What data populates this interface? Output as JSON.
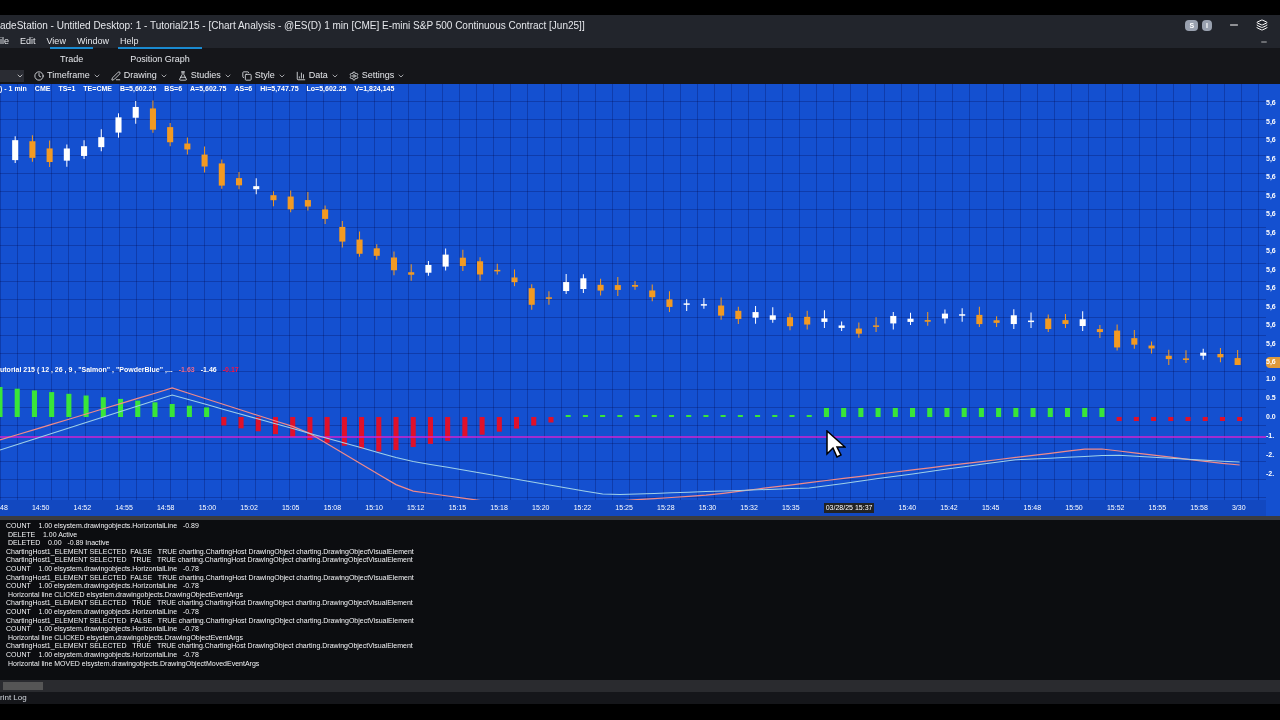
{
  "window": {
    "title": "adeStation  - Untitled Desktop: 1 - Tutorial215 - [Chart Analysis - @ES(D) 1 min [CME] E-mini S&P 500 Continuous Contract [Jun25]]",
    "buttons": [
      "S",
      "I"
    ]
  },
  "menu": [
    "ile",
    "Edit",
    "View",
    "Window",
    "Help"
  ],
  "tabs": [
    "Trade",
    "Position Graph"
  ],
  "toolbar": [
    "Timeframe",
    "Drawing",
    "Studies",
    "Style",
    "Data",
    "Settings"
  ],
  "chart": {
    "status_line": [
      ") - 1 min",
      "CME",
      "TS=1",
      "TE=CME",
      "B=5,602.25",
      "BS=6",
      "A=5,602.75",
      "AS=6",
      "Hi=5,747.75",
      "Lo=5,602.25",
      "V=1,824,145"
    ],
    "price_axis": [
      "5,6",
      "5,6",
      "5,6",
      "5,6",
      "5,6",
      "5,6",
      "5,6",
      "5,6",
      "5,6",
      "5,6",
      "5,6",
      "5,6",
      "5,6",
      "5,6"
    ],
    "last_price_tag": "5,6",
    "study_label": "utorial 215 ( 12 , 26 , 9 , \"Salmon\" , \"PowderBlue\" ,...",
    "study_values": [
      "-1.63",
      "-1.46",
      "-0.17"
    ],
    "indicator_axis": [
      "1.0",
      "0.5",
      "0.0",
      "-1.",
      "-2.",
      "-2."
    ],
    "time_axis": [
      {
        "text": "48",
        "highlighted": false
      },
      {
        "text": "14:50",
        "highlighted": false
      },
      {
        "text": "14:52",
        "highlighted": false
      },
      {
        "text": "14:55",
        "highlighted": false
      },
      {
        "text": "14:58",
        "highlighted": false
      },
      {
        "text": "15:00",
        "highlighted": false
      },
      {
        "text": "15:02",
        "highlighted": false
      },
      {
        "text": "15:05",
        "highlighted": false
      },
      {
        "text": "15:08",
        "highlighted": false
      },
      {
        "text": "15:10",
        "highlighted": false
      },
      {
        "text": "15:12",
        "highlighted": false
      },
      {
        "text": "15:15",
        "highlighted": false
      },
      {
        "text": "15:18",
        "highlighted": false
      },
      {
        "text": "15:20",
        "highlighted": false
      },
      {
        "text": "15:22",
        "highlighted": false
      },
      {
        "text": "15:25",
        "highlighted": false
      },
      {
        "text": "15:28",
        "highlighted": false
      },
      {
        "text": "15:30",
        "highlighted": false
      },
      {
        "text": "15:32",
        "highlighted": false
      },
      {
        "text": "15:35",
        "highlighted": false
      },
      {
        "text": "03/28/25 15:37",
        "highlighted": true
      },
      {
        "text": "15:40",
        "highlighted": false
      },
      {
        "text": "15:42",
        "highlighted": false
      },
      {
        "text": "15:45",
        "highlighted": false
      },
      {
        "text": "15:48",
        "highlighted": false
      },
      {
        "text": "15:50",
        "highlighted": false
      },
      {
        "text": "15:52",
        "highlighted": false
      },
      {
        "text": "15:55",
        "highlighted": false
      },
      {
        "text": "15:58",
        "highlighted": false
      },
      {
        "text": "3/30",
        "highlighted": false
      }
    ]
  },
  "log": {
    "lines": [
      "COUNT    1.00 elsystem.drawingobjects.HorizontalLine   -0.89",
      " DELETE    1.00 Active",
      " DELETED    0.00   -0.89 Inactive",
      "ChartingHost1_ELEMENT SELECTED  FALSE   TRUE charting.ChartingHost DrawingObject charting.DrawingObjectVisualElement",
      "ChartingHost1_ELEMENT SELECTED   TRUE   TRUE charting.ChartingHost DrawingObject charting.DrawingObjectVisualElement",
      "COUNT    1.00 elsystem.drawingobjects.HorizontalLine   -0.78",
      "ChartingHost1_ELEMENT SELECTED  FALSE   TRUE charting.ChartingHost DrawingObject charting.DrawingObjectVisualElement",
      "COUNT    1.00 elsystem.drawingobjects.HorizontalLine   -0.78",
      " Horizontal line CLICKED elsystem.drawingobjects.DrawingObjectEventArgs",
      "ChartingHost1_ELEMENT SELECTED   TRUE   TRUE charting.ChartingHost DrawingObject charting.DrawingObjectVisualElement",
      "COUNT    1.00 elsystem.drawingobjects.HorizontalLine   -0.78",
      "ChartingHost1_ELEMENT SELECTED  FALSE   TRUE charting.ChartingHost DrawingObject charting.DrawingObjectVisualElement",
      "COUNT    1.00 elsystem.drawingobjects.HorizontalLine   -0.78",
      " Horizontal line CLICKED elsystem.drawingobjects.DrawingObjectEventArgs",
      "ChartingHost1_ELEMENT SELECTED   TRUE   TRUE charting.ChartingHost DrawingObject charting.DrawingObjectVisualElement",
      "COUNT    1.00 elsystem.drawingobjects.HorizontalLine   -0.78",
      " Horizontal line MOVED elsystem.drawingobjects.DrawingObjectMovedEventArgs"
    ],
    "tab": "rint Log"
  }
}
